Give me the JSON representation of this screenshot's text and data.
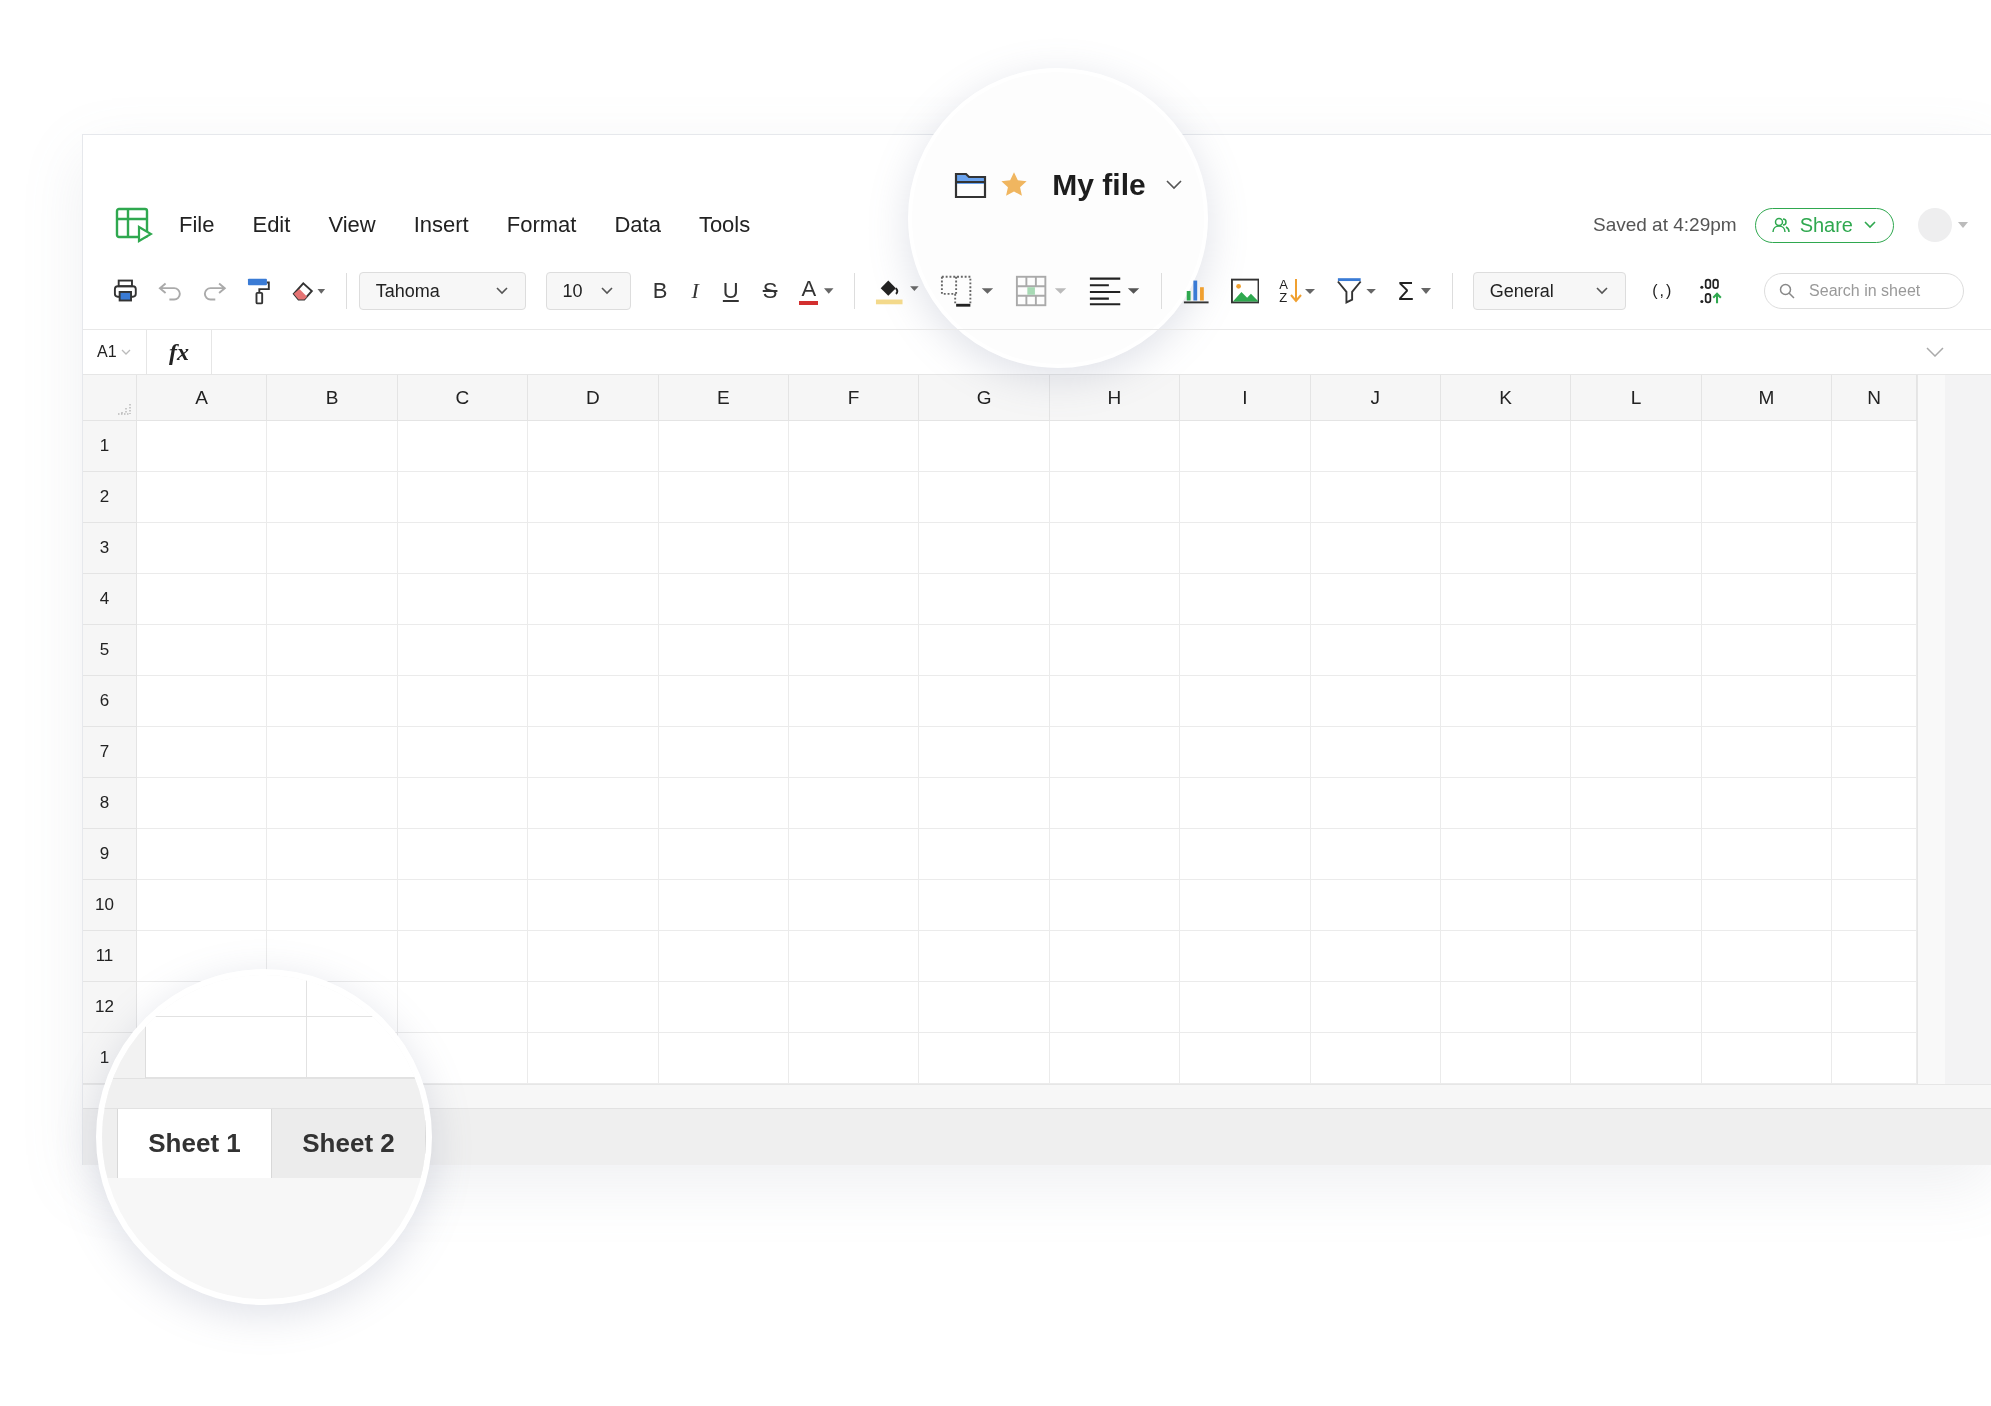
{
  "title": "My file",
  "menu": [
    "File",
    "Edit",
    "View",
    "Insert",
    "Format",
    "Data",
    "Tools"
  ],
  "saved_status": "Saved at 4:29pm",
  "share_button": "Share",
  "toolbar": {
    "font": "Tahoma",
    "font_size": "10",
    "format_buttons": [
      {
        "kind": "bold",
        "label": "B"
      },
      {
        "kind": "italic",
        "label": "I"
      },
      {
        "kind": "underline",
        "label": "U"
      },
      {
        "kind": "strike",
        "label": "S"
      },
      {
        "kind": "color",
        "label": "A"
      }
    ],
    "sort": {
      "top": "A",
      "bottom": "Z"
    },
    "sum": "Σ",
    "number_format": "General",
    "comma_style": "(,)",
    "search_placeholder": "Search in sheet"
  },
  "formula_bar": {
    "cell_ref": "A1",
    "fx": "fx"
  },
  "columns": [
    "A",
    "B",
    "C",
    "D",
    "E",
    "F",
    "G",
    "H",
    "I",
    "J",
    "K",
    "L",
    "M",
    "N"
  ],
  "rows": [
    "1",
    "2",
    "3",
    "4",
    "5",
    "6",
    "7",
    "8",
    "9",
    "10",
    "11",
    "12",
    "1"
  ],
  "sheets": [
    {
      "label": "Sheet 1",
      "selected": true
    },
    {
      "label": "Sheet 2",
      "selected": false
    }
  ]
}
